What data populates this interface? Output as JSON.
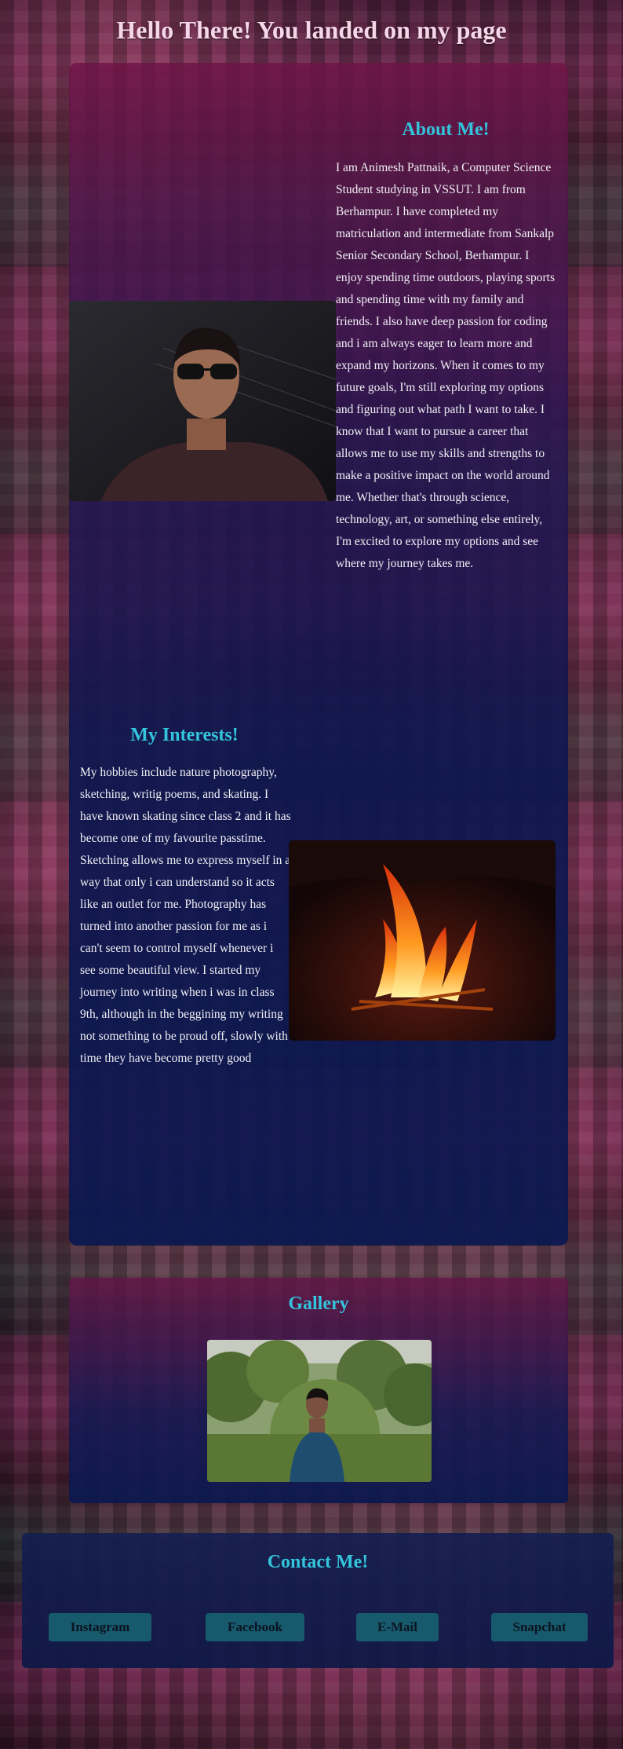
{
  "page": {
    "title": "Hello There! You landed on my page"
  },
  "about": {
    "heading": "About Me!",
    "text": "I am Animesh Pattnaik, a Computer Science Student studying in VSSUT. I am from Berhampur. I have completed my matriculation and intermediate from Sankalp Senior Secondary School, Berhampur. I enjoy spending time outdoors, playing sports and spending time with my family and friends. I also have deep passion for coding and i am always eager to learn more and expand my horizons. When it comes to my future goals, I'm still exploring my options and figuring out what path I want to take. I know that I want to pursue a career that allows me to use my skills and strengths to make a positive impact on the world around me. Whether that's through science, technology, art, or something else entirely, I'm excited to explore my options and see where my journey takes me."
  },
  "interests": {
    "heading": "My Interests!",
    "text": "My hobbies include nature photography, sketching, writig poems, and skating. I have known skating since class 2 and it has become one of my favourite passtime. Sketching allows me to express myself in a way that only i can understand so it acts like an outlet for me. Photography has turned into another passion for me as i can't seem to control myself whenever i see some beautiful view. I started my journey into writing when i was in class 9th, although in the beggining my writing not something to be proud off, slowly with time they have become pretty good"
  },
  "gallery": {
    "heading": "Gallery"
  },
  "contact": {
    "heading": "Contact Me!",
    "buttons": [
      "Instagram",
      "Facebook",
      "E-Mail",
      "Snapchat"
    ]
  },
  "colors": {
    "heading_accent": "#34c4dc",
    "title": "#f6d7e9",
    "button_bg": "#175a6d"
  }
}
